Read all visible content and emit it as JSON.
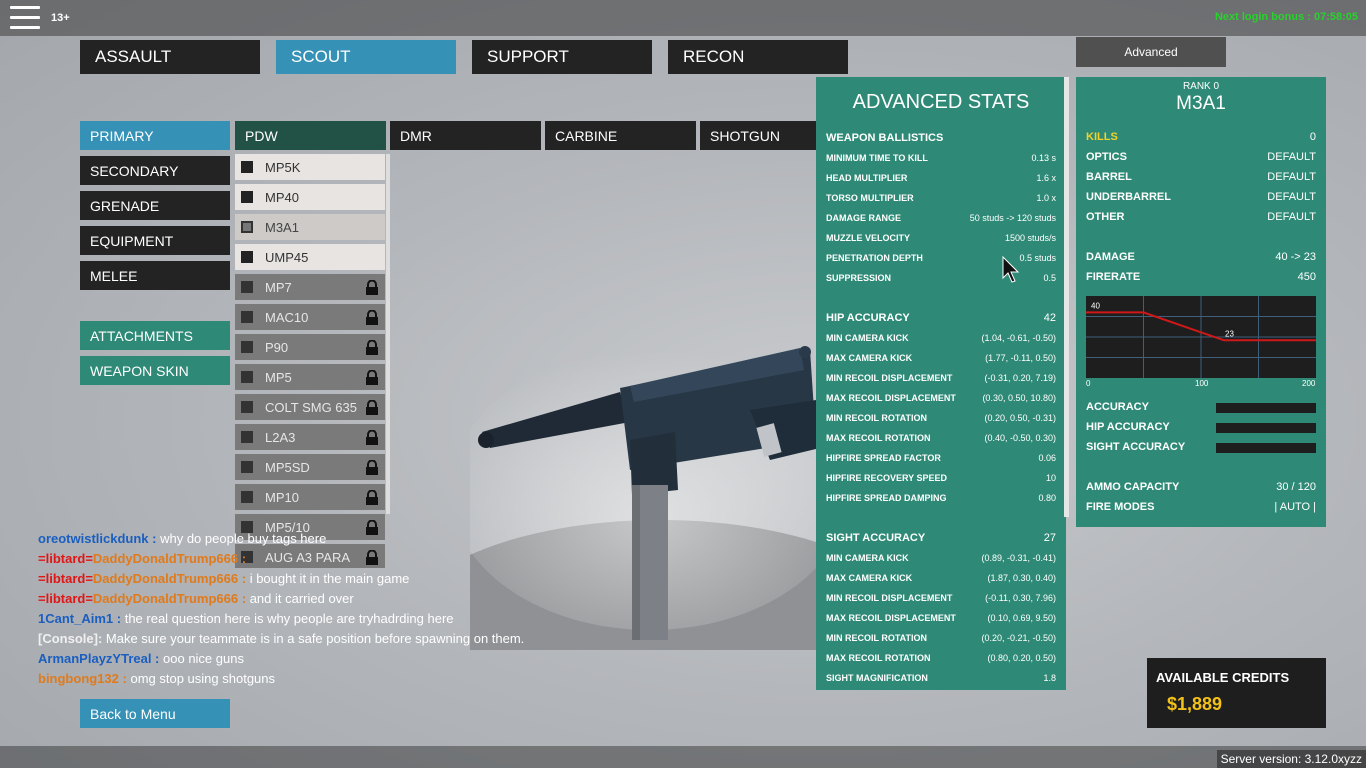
{
  "topbar": {
    "age_badge": "13+",
    "login_bonus": "Next login bonus : 07:58:05"
  },
  "class_tabs": [
    {
      "label": "ASSAULT",
      "active": false
    },
    {
      "label": "SCOUT",
      "active": true
    },
    {
      "label": "SUPPORT",
      "active": false
    },
    {
      "label": "RECON",
      "active": false
    }
  ],
  "slot_menu": {
    "items": [
      "PRIMARY",
      "SECONDARY",
      "GRENADE",
      "EQUIPMENT",
      "MELEE"
    ],
    "attachments": "ATTACHMENTS",
    "weapon_skin": "WEAPON SKIN"
  },
  "category_tabs": [
    "PDW",
    "DMR",
    "CARBINE",
    "SHOTGUN"
  ],
  "weapons": [
    {
      "name": "MP5K",
      "state": "unlocked"
    },
    {
      "name": "MP40",
      "state": "unlocked"
    },
    {
      "name": "M3A1",
      "state": "selected"
    },
    {
      "name": "UMP45",
      "state": "unlocked"
    },
    {
      "name": "MP7",
      "state": "locked"
    },
    {
      "name": "MAC10",
      "state": "locked"
    },
    {
      "name": "P90",
      "state": "locked"
    },
    {
      "name": "MP5",
      "state": "locked"
    },
    {
      "name": "COLT SMG 635",
      "state": "locked"
    },
    {
      "name": "L2A3",
      "state": "locked"
    },
    {
      "name": "MP5SD",
      "state": "locked"
    },
    {
      "name": "MP10",
      "state": "locked"
    },
    {
      "name": "MP5/10",
      "state": "locked"
    },
    {
      "name": "AUG A3 PARA",
      "state": "locked"
    }
  ],
  "advanced_stats": {
    "title": "ADVANCED STATS",
    "ballistics_header": "WEAPON BALLISTICS",
    "ballistics": [
      {
        "label": "MINIMUM TIME TO KILL",
        "value": "0.13 s"
      },
      {
        "label": "HEAD MULTIPLIER",
        "value": "1.6 x"
      },
      {
        "label": "TORSO MULTIPLIER",
        "value": "1.0 x"
      },
      {
        "label": "DAMAGE RANGE",
        "value": "50 studs -> 120 studs"
      },
      {
        "label": "MUZZLE VELOCITY",
        "value": "1500 studs/s"
      },
      {
        "label": "PENETRATION DEPTH",
        "value": "0.5 studs"
      },
      {
        "label": "SUPPRESSION",
        "value": "0.5"
      }
    ],
    "hip_header": "HIP ACCURACY",
    "hip_value": "42",
    "hip": [
      {
        "label": "MIN CAMERA KICK",
        "value": "(1.04, -0.61, -0.50)"
      },
      {
        "label": "MAX CAMERA KICK",
        "value": "(1.77, -0.11, 0.50)"
      },
      {
        "label": "MIN RECOIL DISPLACEMENT",
        "value": "(-0.31, 0.20, 7.19)"
      },
      {
        "label": "MAX RECOIL DISPLACEMENT",
        "value": "(0.30, 0.50, 10.80)"
      },
      {
        "label": "MIN RECOIL ROTATION",
        "value": "(0.20, 0.50, -0.31)"
      },
      {
        "label": "MAX RECOIL ROTATION",
        "value": "(0.40, -0.50, 0.30)"
      },
      {
        "label": "HIPFIRE SPREAD FACTOR",
        "value": "0.06"
      },
      {
        "label": "HIPFIRE RECOVERY SPEED",
        "value": "10"
      },
      {
        "label": "HIPFIRE SPREAD DAMPING",
        "value": "0.80"
      }
    ],
    "sight_header": "SIGHT ACCURACY",
    "sight_value": "27",
    "sight": [
      {
        "label": "MIN CAMERA KICK",
        "value": "(0.89, -0.31, -0.41)"
      },
      {
        "label": "MAX CAMERA KICK",
        "value": "(1.87, 0.30, 0.40)"
      },
      {
        "label": "MIN RECOIL DISPLACEMENT",
        "value": "(-0.11, 0.30, 7.96)"
      },
      {
        "label": "MAX RECOIL DISPLACEMENT",
        "value": "(0.10, 0.69, 9.50)"
      },
      {
        "label": "MIN RECOIL ROTATION",
        "value": "(0.20, -0.21, -0.50)"
      },
      {
        "label": "MAX RECOIL ROTATION",
        "value": "(0.80, 0.20, 0.50)"
      },
      {
        "label": "SIGHT MAGNIFICATION",
        "value": "1.8"
      }
    ]
  },
  "advanced_button": "Advanced",
  "weapon_info": {
    "rank": "RANK 0",
    "name": "M3A1",
    "kills_label": "KILLS",
    "kills": "0",
    "attachments": [
      {
        "label": "OPTICS",
        "value": "DEFAULT"
      },
      {
        "label": "BARREL",
        "value": "DEFAULT"
      },
      {
        "label": "UNDERBARREL",
        "value": "DEFAULT"
      },
      {
        "label": "OTHER",
        "value": "DEFAULT"
      }
    ],
    "damage_label": "DAMAGE",
    "damage": "40 -> 23",
    "firerate_label": "FIRERATE",
    "firerate": "450",
    "graph": {
      "x_ticks": [
        "0",
        "100",
        "200"
      ],
      "x_max": 200,
      "y_max": 50,
      "points": [
        [
          0,
          40
        ],
        [
          50,
          40
        ],
        [
          120,
          23
        ],
        [
          200,
          23
        ]
      ],
      "label_high": "40",
      "label_low": "23",
      "line_color": "#d01818"
    },
    "accuracy_label": "ACCURACY",
    "hip_accuracy_label": "HIP ACCURACY",
    "sight_accuracy_label": "SIGHT ACCURACY",
    "ammo_label": "AMMO CAPACITY",
    "ammo": "30 / 120",
    "fire_modes_label": "FIRE MODES",
    "fire_modes": "|  AUTO  |"
  },
  "credits": {
    "label": "AVAILABLE CREDITS",
    "value": "$1,889"
  },
  "chat": [
    {
      "tag": "",
      "user": "oreotwistlickdunk :",
      "user_color": "#1a5fc0",
      "msg": "why do people buy tags here"
    },
    {
      "tag": "=libtard=",
      "user": "DaddyDonaldTrump666 :",
      "user_color": "#e07a1a",
      "msg": ""
    },
    {
      "tag": "=libtard=",
      "user": "DaddyDonaldTrump666 :",
      "user_color": "#e07a1a",
      "msg": "i bought it in the main game"
    },
    {
      "tag": "=libtard=",
      "user": "DaddyDonaldTrump666 :",
      "user_color": "#e07a1a",
      "msg": "and it carried over"
    },
    {
      "tag": "",
      "user": "1Cant_Aim1 :",
      "user_color": "#1a5fc0",
      "msg": "the real question here is why people are tryhadrding here"
    },
    {
      "tag": "",
      "user": "[Console]:",
      "user_color": "#f0f0f0",
      "msg": "Make sure your teammate is in a safe position before spawning on them."
    },
    {
      "tag": "",
      "user": "ArmanPlayzYTreal :",
      "user_color": "#1a5fc0",
      "msg": "ooo nice guns"
    },
    {
      "tag": "",
      "user": "bingbong132 :",
      "user_color": "#e07a1a",
      "msg": "omg stop using shotguns"
    }
  ],
  "back_button": "Back to Menu",
  "server_version": "Server version: 3.12.0xyzz"
}
